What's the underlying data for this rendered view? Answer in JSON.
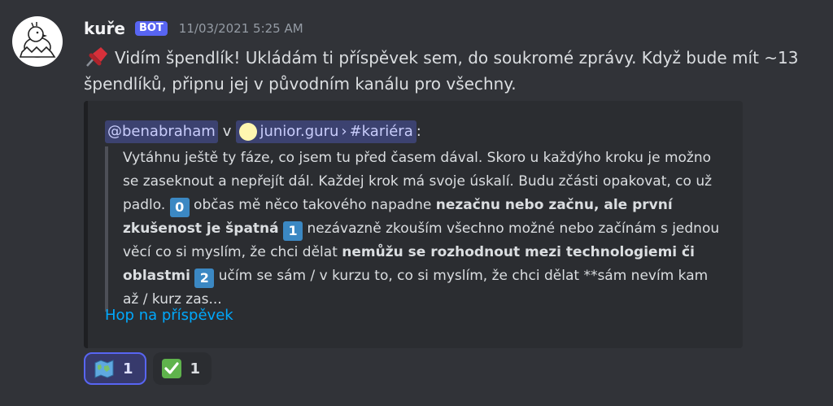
{
  "author": {
    "name": "kuře",
    "bot_tag": "BOT",
    "timestamp": "11/03/2021 5:25 AM"
  },
  "message": {
    "pin_icon": "pushpin-icon",
    "text": "Vidím špendlík! Ukládám ti příspěvek sem, do soukromé zprávy. Když bude mít ~13 špendlíků, připnu jej v původním kanálu pro všechny."
  },
  "embed": {
    "mention": "@benabraham",
    "connector": "v",
    "server": "junior.guru",
    "separator": "›",
    "channel": "#kariéra",
    "colon": ":",
    "quote": {
      "p1": "Vytáhnu ještě ty fáze, co jsem tu před časem dával. Skoro u každýho kroku je možno se zaseknout a nepřejít dál. Každej krok má svoje úskalí. Budu zčásti opakovat, co už padlo. ",
      "k0": "0",
      "p2": " občas mě něco takového napadne ",
      "b1": "nezačnu nebo začnu, ale první zkušenost je špatná",
      "k1": "1",
      "p3": " nezávazně zkouším všechno možné nebo začínám s jednou věcí co si myslím, že chci dělat ",
      "b2": "nemůžu se rozhodnout mezi technologiemi či oblastmi",
      "k2": "2",
      "p4": " učím se sám / v kurzu to, co si myslím, že chci dělat **sám nevím kam až / kurz zas..."
    },
    "link": "Hop na příspěvek"
  },
  "reactions": [
    {
      "icon": "world-map-icon",
      "count": "1",
      "active": true
    },
    {
      "icon": "check-mark-icon",
      "count": "1",
      "active": false
    }
  ],
  "colors": {
    "background": "#313338",
    "bot_tag": "#5865f2",
    "link": "#00a8fc",
    "keycap": "#3b88c3"
  }
}
